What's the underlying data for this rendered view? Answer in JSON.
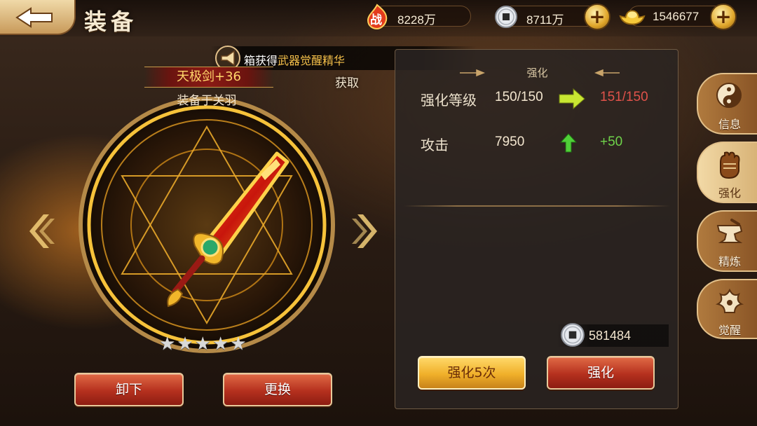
{
  "header": {
    "title": "装备",
    "resources": [
      {
        "name": "combat-power",
        "icon_text": "战",
        "value": "8228万"
      },
      {
        "name": "copper-coins",
        "value": "8711万"
      },
      {
        "name": "gold-ingots",
        "value": "1546677"
      }
    ]
  },
  "announcement": {
    "prefix": "箱获得",
    "highlight": "武器觉醒精华"
  },
  "equipment": {
    "name": "天极剑+36",
    "equipped_on": "装备于关羽",
    "stars": 5,
    "star_glyph": "★",
    "unequip_label": "卸下",
    "replace_label": "更换"
  },
  "acquire_label": "获取",
  "enhance": {
    "section_title": "强化",
    "level_label": "强化等级",
    "level_current": "150/150",
    "level_next": "151/150",
    "attack_label": "攻击",
    "attack_current": "7950",
    "attack_gain": "+50",
    "cost": "581484",
    "enhance5_label": "强化5次",
    "enhance_label": "强化"
  },
  "side_tabs": [
    {
      "label": "信息",
      "icon": "yin-yang-icon",
      "active": false
    },
    {
      "label": "强化",
      "icon": "fist-icon",
      "active": true
    },
    {
      "label": "精炼",
      "icon": "anvil-icon",
      "active": false
    },
    {
      "label": "觉醒",
      "icon": "awaken-icon",
      "active": false
    }
  ],
  "colors": {
    "next_level": "#e0524a",
    "gain": "#6fd34a",
    "highlight": "#f5c04a"
  }
}
